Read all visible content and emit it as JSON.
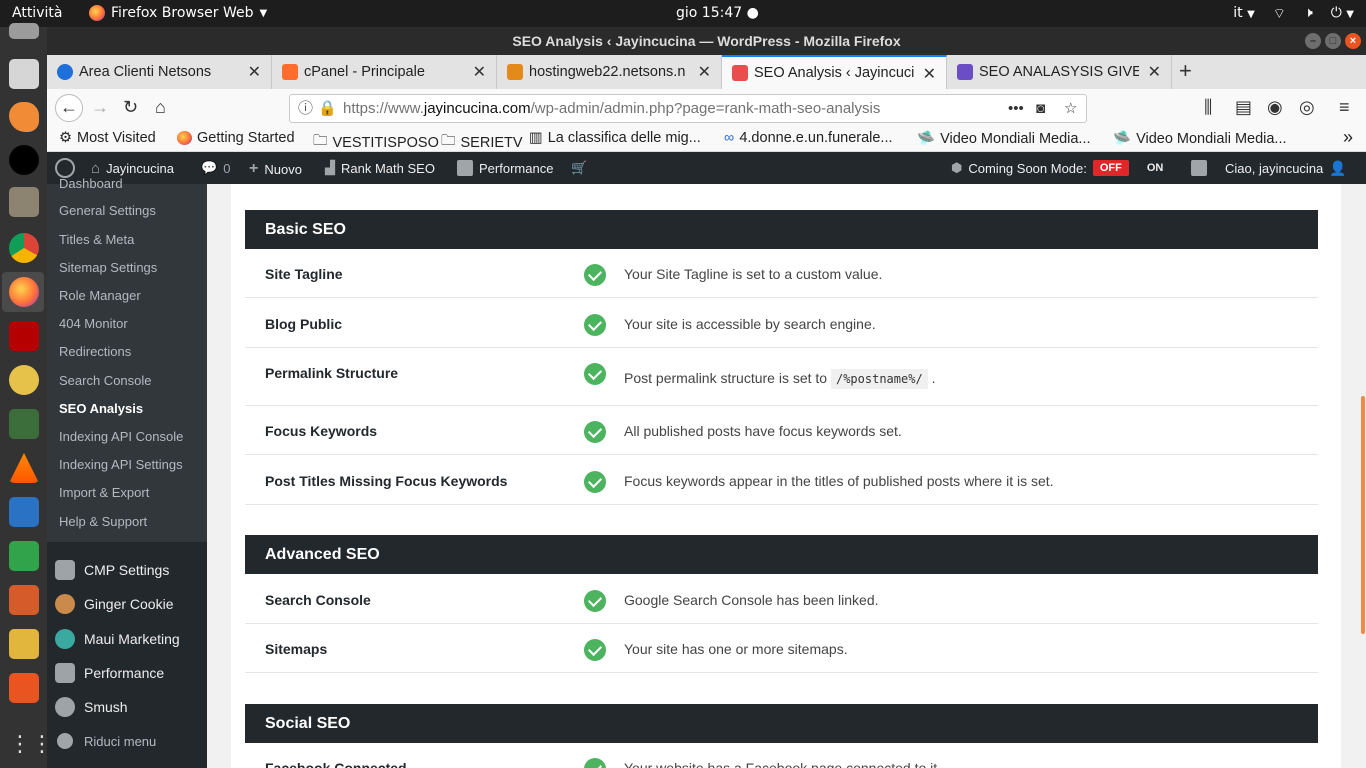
{
  "system": {
    "activities": "Attività",
    "app_name": "Firefox Browser Web",
    "clock": "gio 15:47 ●",
    "lang": "it",
    "tray_icons": [
      "network-icon",
      "volume-icon",
      "power-icon"
    ]
  },
  "window": {
    "title": "SEO Analysis ‹ Jayincucina — WordPress - Mozilla Firefox"
  },
  "tabs": [
    {
      "title": "Area Clienti Netsons",
      "color": "#1e6fd9"
    },
    {
      "title": "cPanel - Principale",
      "color": "#ff6c2c"
    },
    {
      "title": "hostingweb22.netsons.n",
      "color": "#e48a1a"
    },
    {
      "title": "SEO Analysis ‹ Jayincucin",
      "color": "#e94e4e"
    },
    {
      "title": "SEO ANALASYSIS GIVE M",
      "color": "#6b4ec6"
    }
  ],
  "url": {
    "prefix": "https://www.",
    "domain": "jayincucina.com",
    "path": "/wp-admin/admin.php?page=rank-math-seo-analysis"
  },
  "bookmarks": [
    {
      "label": "Most Visited",
      "icon": "gear-icon"
    },
    {
      "label": "Getting Started",
      "icon": "firefox-icon"
    },
    {
      "label": "VESTITISPOSO",
      "icon": "folder-icon"
    },
    {
      "label": "SERIETV",
      "icon": "folder-icon"
    },
    {
      "label": "La classifica delle mig...",
      "icon": "page-icon"
    },
    {
      "label": "4.donne.e.un.funerale...",
      "icon": "link-icon"
    },
    {
      "label": "Video Mondiali Media...",
      "icon": "video-icon"
    },
    {
      "label": "Video Mondiali Media...",
      "icon": "video-icon"
    }
  ],
  "adminbar": {
    "site": "Jayincucina",
    "comments": "0",
    "new": "Nuovo",
    "rank_math": "Rank Math SEO",
    "performance": "Performance",
    "coming_soon": "Coming Soon Mode:",
    "off": "OFF",
    "on": "ON",
    "greeting": "Ciao, jayincucina"
  },
  "sidebar": {
    "submenu": [
      {
        "label": "Dashboard"
      },
      {
        "label": "General Settings"
      },
      {
        "label": "Titles & Meta"
      },
      {
        "label": "Sitemap Settings"
      },
      {
        "label": "Role Manager"
      },
      {
        "label": "404 Monitor"
      },
      {
        "label": "Redirections"
      },
      {
        "label": "Search Console"
      },
      {
        "label": "SEO Analysis"
      },
      {
        "label": "Indexing API Console"
      },
      {
        "label": "Indexing API Settings"
      },
      {
        "label": "Import & Export"
      },
      {
        "label": "Help & Support"
      }
    ],
    "menu": [
      {
        "label": "CMP Settings"
      },
      {
        "label": "Ginger Cookie"
      },
      {
        "label": "Maui Marketing"
      },
      {
        "label": "Performance"
      },
      {
        "label": "Smush"
      },
      {
        "label": "Riduci menu"
      }
    ]
  },
  "sections": [
    {
      "title": "Basic SEO",
      "rows": [
        {
          "label": "Site Tagline",
          "message": "Your Site Tagline is set to a custom value."
        },
        {
          "label": "Blog Public",
          "message": "Your site is accessible by search engine."
        },
        {
          "label": "Permalink Structure",
          "message": "Post permalink structure is set to",
          "code": "/%postname%/",
          "suffix": "."
        },
        {
          "label": "Focus Keywords",
          "message": "All published posts have focus keywords set."
        },
        {
          "label": "Post Titles Missing Focus Keywords",
          "message": "Focus keywords appear in the titles of published posts where it is set."
        }
      ]
    },
    {
      "title": "Advanced SEO",
      "rows": [
        {
          "label": "Search Console",
          "message": "Google Search Console has been linked."
        },
        {
          "label": "Sitemaps",
          "message": "Your site has one or more sitemaps."
        }
      ]
    },
    {
      "title": "Social SEO",
      "rows": [
        {
          "label": "Facebook Connected",
          "message": "Your website has a Facebook page connected to it."
        }
      ]
    }
  ]
}
